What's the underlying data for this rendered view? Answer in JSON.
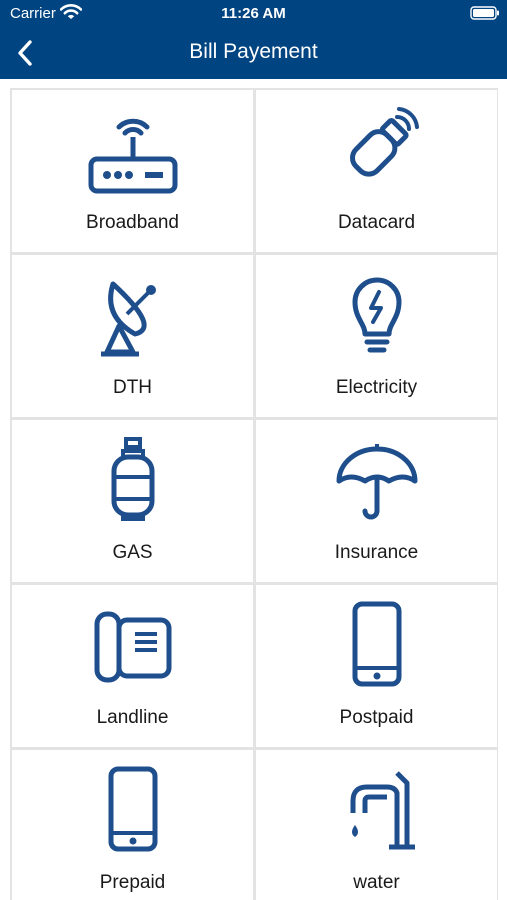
{
  "status_bar": {
    "carrier": "Carrier",
    "time": "11:26 AM"
  },
  "nav": {
    "title": "Bill Payement",
    "back_icon": "chevron-left-icon"
  },
  "colors": {
    "brand": "#004481",
    "icon": "#1f4e8c",
    "tile_bg": "#ffffff",
    "grid_border": "#e3e3e3"
  },
  "services": [
    {
      "label": "Broadband",
      "icon": "router-icon"
    },
    {
      "label": "Datacard",
      "icon": "usb-modem-icon"
    },
    {
      "label": "DTH",
      "icon": "satellite-dish-icon"
    },
    {
      "label": "Electricity",
      "icon": "lightbulb-icon"
    },
    {
      "label": "GAS",
      "icon": "gas-cylinder-icon"
    },
    {
      "label": "Insurance",
      "icon": "umbrella-icon"
    },
    {
      "label": "Landline",
      "icon": "landline-phone-icon"
    },
    {
      "label": "Postpaid",
      "icon": "mobile-phone-icon"
    },
    {
      "label": "Prepaid",
      "icon": "mobile-phone-icon"
    },
    {
      "label": "water",
      "icon": "water-tap-icon"
    }
  ]
}
